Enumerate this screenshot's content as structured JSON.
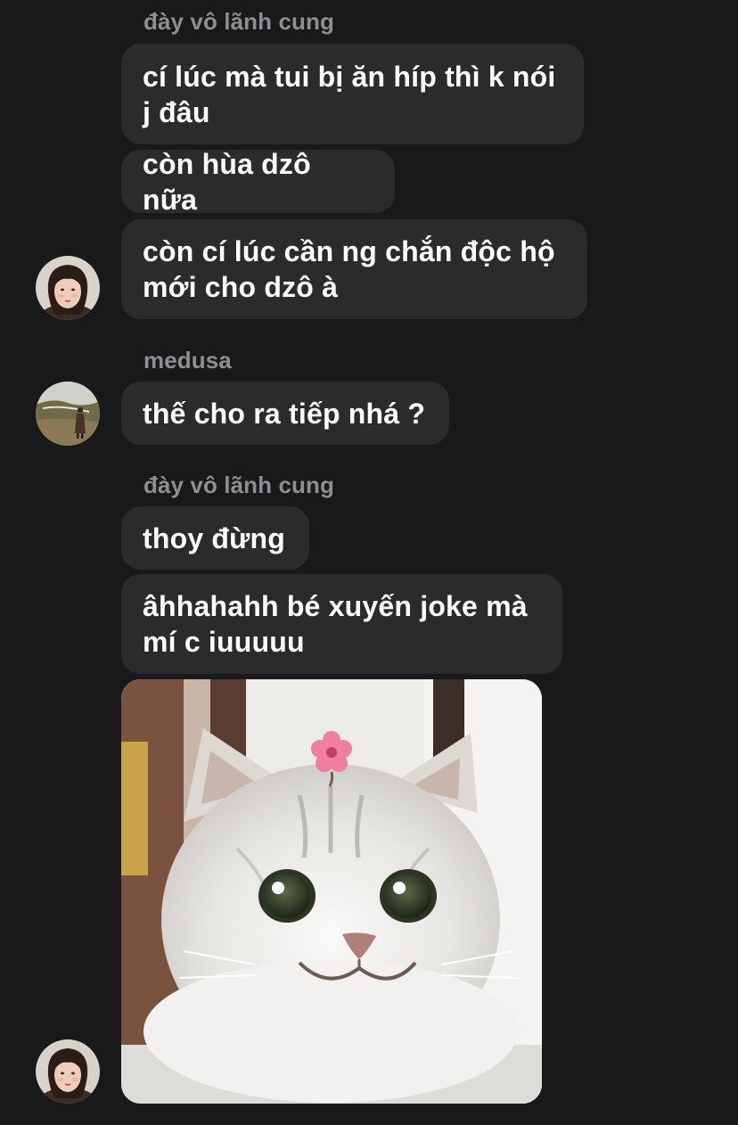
{
  "conversation": {
    "groups": [
      {
        "sender": "đày vô lãnh cung",
        "messages": [
          "cí lúc mà tui bị ăn híp thì k nói j đâu",
          "còn hùa dzô nữa",
          "còn cí lúc cần ng chắn độc hộ mới cho dzô à"
        ]
      },
      {
        "sender": "medusa",
        "messages": [
          "thế cho ra tiếp nhá ?"
        ]
      },
      {
        "sender": "đày vô lãnh cung",
        "messages": [
          "thoy đừng",
          "âhhahahh bé xuyến joke mà mí c iuuuuu"
        ],
        "image": "smiling-cat-with-flower-sticker"
      }
    ]
  },
  "colors": {
    "background": "#19191b",
    "bubble": "#2b2b2e",
    "text": "#ffffff",
    "sender_name": "#8e8e93"
  },
  "icons": {
    "avatar_1": "avatar-girl-icon",
    "avatar_2": "avatar-outdoor-person-icon"
  }
}
